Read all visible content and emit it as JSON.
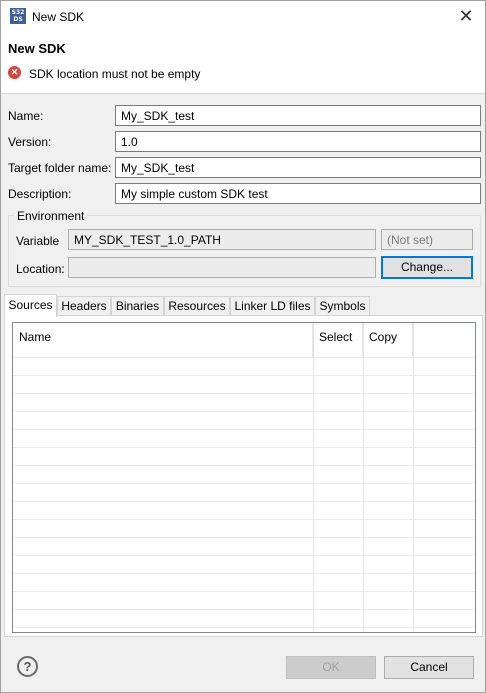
{
  "window": {
    "title": "New SDK",
    "app_icon_text": "S32 DS"
  },
  "header": {
    "title": "New SDK",
    "error_message": "SDK location must not be empty"
  },
  "form": {
    "name_label": "Name:",
    "name_value": "My_SDK_test",
    "version_label": "Version:",
    "version_value": "1.0",
    "target_label": "Target folder name:",
    "target_value": "My_SDK_test",
    "description_label": "Description:",
    "description_value": "My simple custom SDK test"
  },
  "environment": {
    "legend": "Environment",
    "variable_label": "Variable",
    "variable_value": "MY_SDK_TEST_1.0_PATH",
    "variable_status": "(Not set)",
    "location_label": "Location:",
    "location_value": "",
    "change_label": "Change..."
  },
  "tabs": [
    "Sources",
    "Headers",
    "Binaries",
    "Resources",
    "Linker LD files",
    "Symbols"
  ],
  "table": {
    "columns": [
      "Name",
      "Select",
      "Copy"
    ]
  },
  "footer": {
    "help": "?",
    "ok_label": "OK",
    "cancel_label": "Cancel"
  },
  "colors": {
    "accent": "#0078d7",
    "error": "#d9453a"
  }
}
